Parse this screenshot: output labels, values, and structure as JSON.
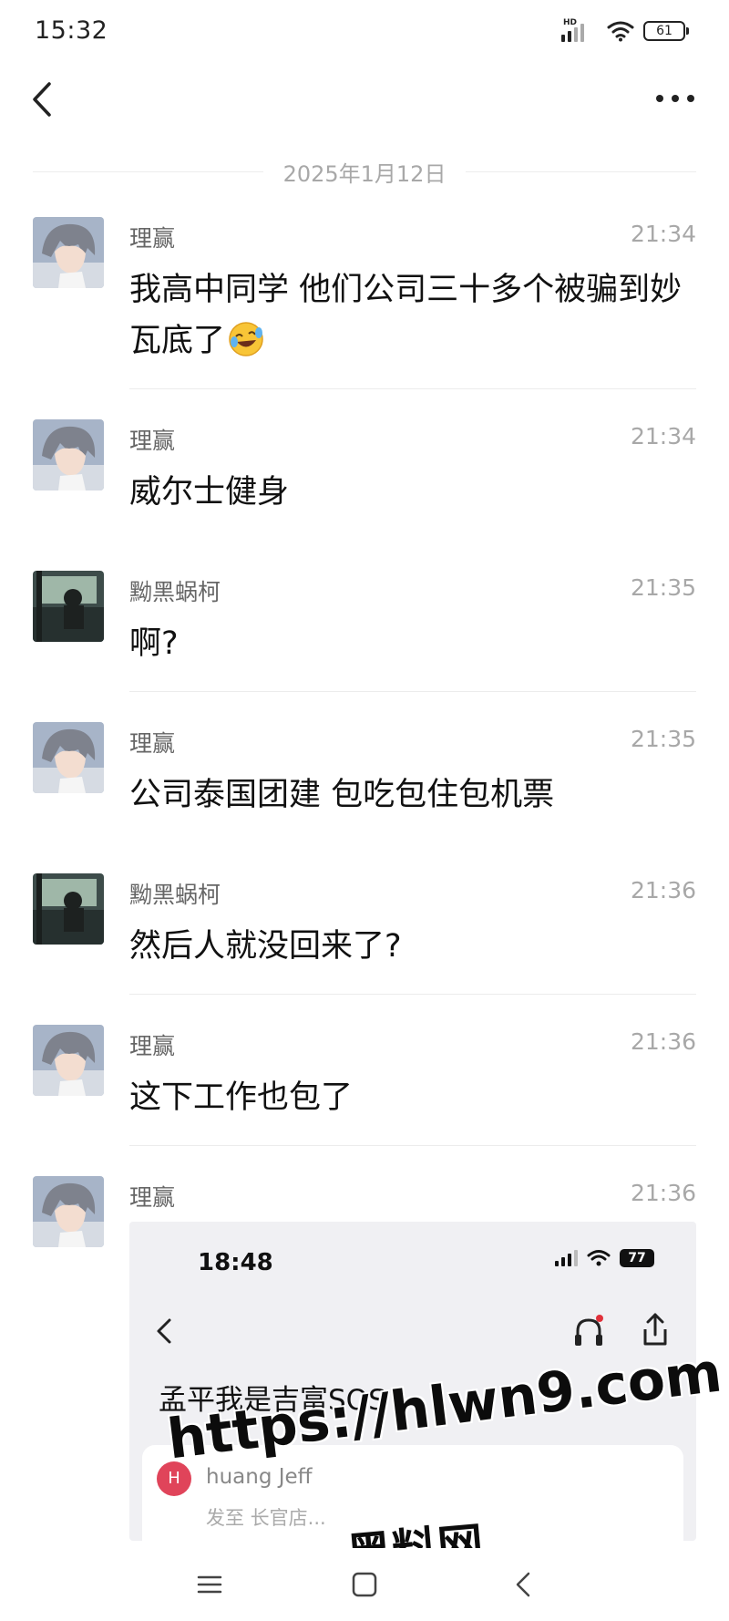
{
  "status_bar": {
    "time": "15:32",
    "network_label": "HD",
    "battery": "61"
  },
  "header": {
    "back_icon": "chevron-left-icon",
    "more_icon": "more-dots-icon"
  },
  "date_divider": "2025年1月12日",
  "messages": [
    {
      "sender": "理赢",
      "time": "21:34",
      "text": "我高中同学 他们公司三十多个被骗到妙瓦底了",
      "emoji": "rolling-on-floor-laughing-emoji",
      "avatar": "anime-boy-avatar"
    },
    {
      "sender": "理赢",
      "time": "21:34",
      "text": "威尔士健身",
      "avatar": "anime-boy-avatar"
    },
    {
      "sender": "黝黑蜗柯",
      "time": "21:35",
      "text": "啊?",
      "avatar": "car-window-avatar"
    },
    {
      "sender": "理赢",
      "time": "21:35",
      "text": "公司泰国团建 包吃包住包机票",
      "avatar": "anime-boy-avatar"
    },
    {
      "sender": "黝黑蜗柯",
      "time": "21:36",
      "text": "然后人就没回来了?",
      "avatar": "car-window-avatar"
    },
    {
      "sender": "理赢",
      "time": "21:36",
      "text": "这下工作也包了",
      "avatar": "anime-boy-avatar"
    },
    {
      "sender": "理赢",
      "time": "21:36",
      "avatar": "anime-boy-avatar"
    }
  ],
  "embedded_screenshot": {
    "time": "18:48",
    "battery": "77",
    "title": "孟平我是吉富SOS",
    "card": {
      "avatar_letter": "H",
      "sender": "huang Jeff",
      "subtitle": "发至 长官店..."
    }
  },
  "watermark": {
    "url": "https://hlwn9.com",
    "name": "黑料网"
  },
  "colors": {
    "text_primary": "#111111",
    "text_secondary": "#666666",
    "text_muted": "#a8a8a8",
    "divider": "#ececec",
    "embed_bg": "#f0f0f3",
    "embed_avatar": "#e0445a"
  },
  "nav": {
    "menu_icon": "menu-lines-icon",
    "home_icon": "home-square-icon",
    "back_icon": "back-chevron-icon"
  }
}
